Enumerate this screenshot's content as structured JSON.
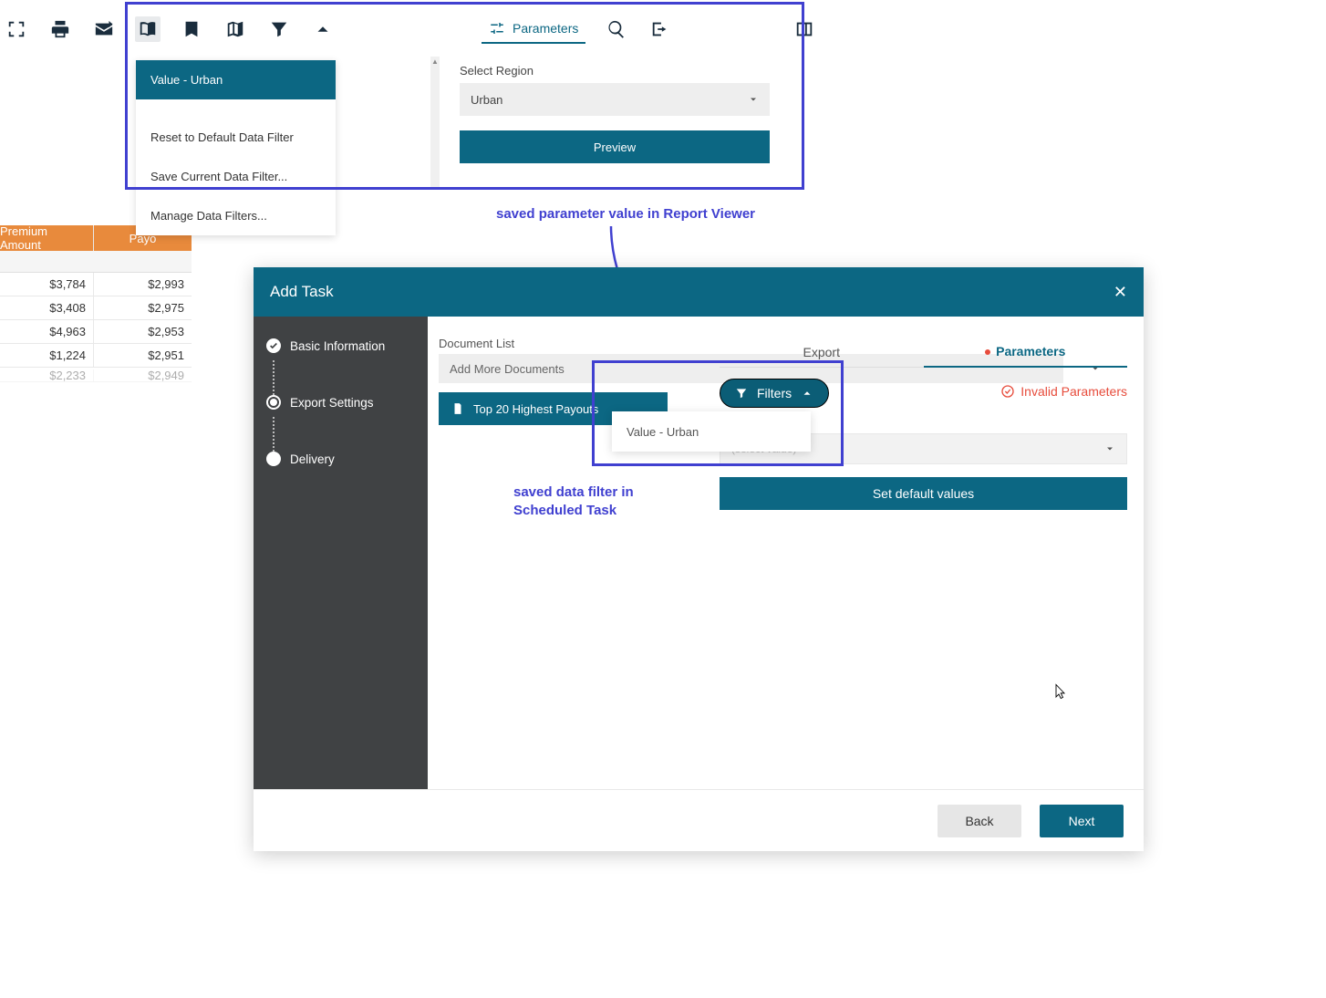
{
  "toolbar": {
    "parameters_label": "Parameters"
  },
  "filter_menu": {
    "selected": "Value - Urban",
    "reset": "Reset to Default Data Filter",
    "save": "Save Current Data Filter...",
    "manage": "Manage Data Filters..."
  },
  "param_panel": {
    "region_label": "Select Region",
    "region_value": "Urban",
    "preview": "Preview"
  },
  "annotation_top": "saved parameter value in Report Viewer",
  "annotation_task_line1": "saved data filter in",
  "annotation_task_line2": "Scheduled Task",
  "table": {
    "headers": {
      "a": "Premium Amount",
      "b": "Payo"
    },
    "rows": [
      {
        "a": "$3,784",
        "b": "$2,993"
      },
      {
        "a": "$3,408",
        "b": "$2,975"
      },
      {
        "a": "$4,963",
        "b": "$2,953"
      },
      {
        "a": "$1,224",
        "b": "$2,951"
      }
    ],
    "cut_row": {
      "a": "$2,233",
      "b": "$2,949"
    }
  },
  "dialog": {
    "title": "Add Task",
    "steps": {
      "basic": "Basic Information",
      "export": "Export Settings",
      "delivery": "Delivery"
    },
    "doclist_label": "Document List",
    "doclist_placeholder": "Add More Documents",
    "doc_item": "Top 20 Highest Payouts",
    "tabs": {
      "export": "Export",
      "parameters": "Parameters"
    },
    "filters_label": "Filters",
    "invalid": "Invalid Parameters",
    "filter_option": "Value - Urban",
    "select_ghost": "(select value)",
    "default_btn": "Set default values",
    "back": "Back",
    "next": "Next"
  }
}
